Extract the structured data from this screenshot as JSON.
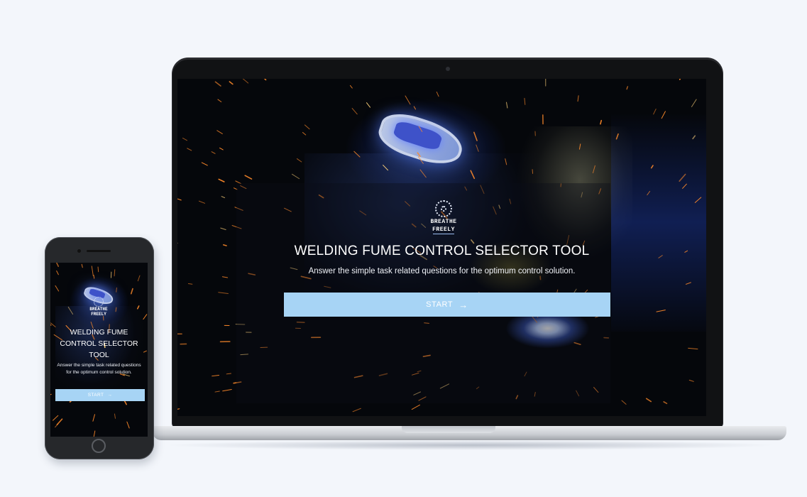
{
  "brand": {
    "logo_line1": "BREATHE",
    "logo_line2": "FREELY"
  },
  "hero": {
    "title": "WELDING FUME CONTROL SELECTOR TOOL",
    "subtitle": "Answer the simple task related questions for the optimum control solution.",
    "start_label": "START",
    "start_arrow": "→"
  },
  "mobile": {
    "title": "WELDING FUME CONTROL SELECTOR TOOL",
    "subtitle": "Answer the simple task related questions for the optimum control solution.",
    "start_label": "START",
    "start_arrow": "→"
  },
  "colors": {
    "accent_button": "#a7d4f5",
    "background": "#f3f6fb",
    "spark": "#ff8a2a"
  },
  "icons": {
    "logo": "breathe-freely-logo",
    "arrow": "arrow-right-icon"
  }
}
